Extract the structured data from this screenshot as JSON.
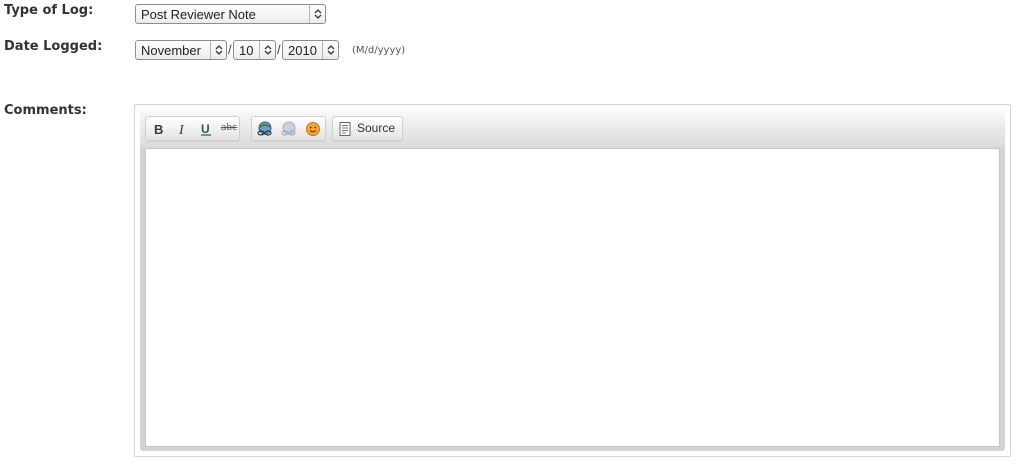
{
  "form": {
    "type_of_log": {
      "label": "Type of Log:",
      "selected": "Post Reviewer Note"
    },
    "date_logged": {
      "label": "Date Logged:",
      "month": "November",
      "day": "10",
      "year": "2010",
      "separator": "/",
      "format_hint": "(M/d/yyyy)"
    },
    "comments": {
      "label": "Comments:",
      "content": ""
    }
  },
  "editor": {
    "toolbar": {
      "bold_icon": "bold-icon",
      "italic_icon": "italic-icon",
      "underline_icon": "underline-icon",
      "strike_label": "abc",
      "link_icon": "link-icon",
      "unlink_icon": "unlink-icon",
      "smiley_icon": "smiley-icon",
      "source_label": "Source"
    }
  }
}
